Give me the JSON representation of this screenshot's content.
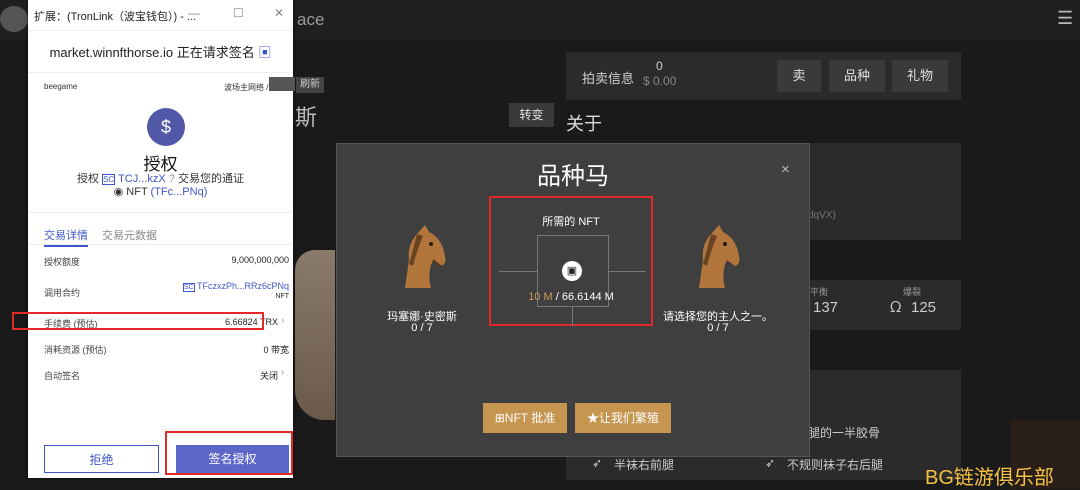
{
  "background": {
    "site_title_fragment": "ace",
    "refresh_badge": "刷新",
    "transfer_button": "转变",
    "name_fragment": "斯",
    "auction_label": "拍卖信息",
    "auction_count": "0",
    "auction_value": "$ 0.00",
    "tabs": [
      "卖",
      "品种",
      "礼物"
    ],
    "about_label": "关于",
    "address_fragment": "dqVX)",
    "balance_label": "平衡",
    "balance_value": "137",
    "burst_label": "爆裂",
    "burst_value": "125",
    "traits": [
      "腿的一半胶骨",
      "半袜右前腿",
      "不规则袜子右后腿"
    ],
    "watermark": "BG链游俱乐部"
  },
  "breed_modal": {
    "title": "品种马",
    "close": "×",
    "left_horse": {
      "name": "玛塞娜·史密斯",
      "count": "0 / 7"
    },
    "nft_required": {
      "title": "所需的 NFT",
      "have": "10 M",
      "need": "/ 66.6144 M"
    },
    "right_horse": {
      "name": "请选择您的主人之一。",
      "count": "0 / 7"
    },
    "buttons": {
      "approve": "⊞NFT 批准",
      "breed": "★让我们繁殖"
    }
  },
  "extension": {
    "window_title": "扩展：(TronLink（波宝钱包）) - ...",
    "host_line": "market.winnfthorse.io 正在请求签名",
    "account": "beegame",
    "network": "波场主网络 / 主链",
    "auth_title": "授权",
    "auth_line1_prefix": "授权",
    "auth_line1_addr": "TCJ...kzX",
    "auth_line1_suffix": "交易您的通证",
    "auth_line2_prefix": "NFT",
    "auth_line2_addr": "(TFc...PNq)",
    "tabs": {
      "details": "交易详情",
      "meta": "交易元数据"
    },
    "rows": [
      {
        "label": "授权额度",
        "value": "9,000,000,000"
      },
      {
        "label": "调用合约",
        "value": "TFczxzPh...RRz6cPNq",
        "sub": "NFT"
      },
      {
        "label": "手续费 (预估)",
        "value": "6.66824 TRX"
      },
      {
        "label": "消耗资源 (预估)",
        "value": "0 带宽"
      },
      {
        "label": "自动签名",
        "value": "关闭"
      }
    ],
    "buttons": {
      "reject": "拒绝",
      "sign": "签名授权"
    }
  }
}
